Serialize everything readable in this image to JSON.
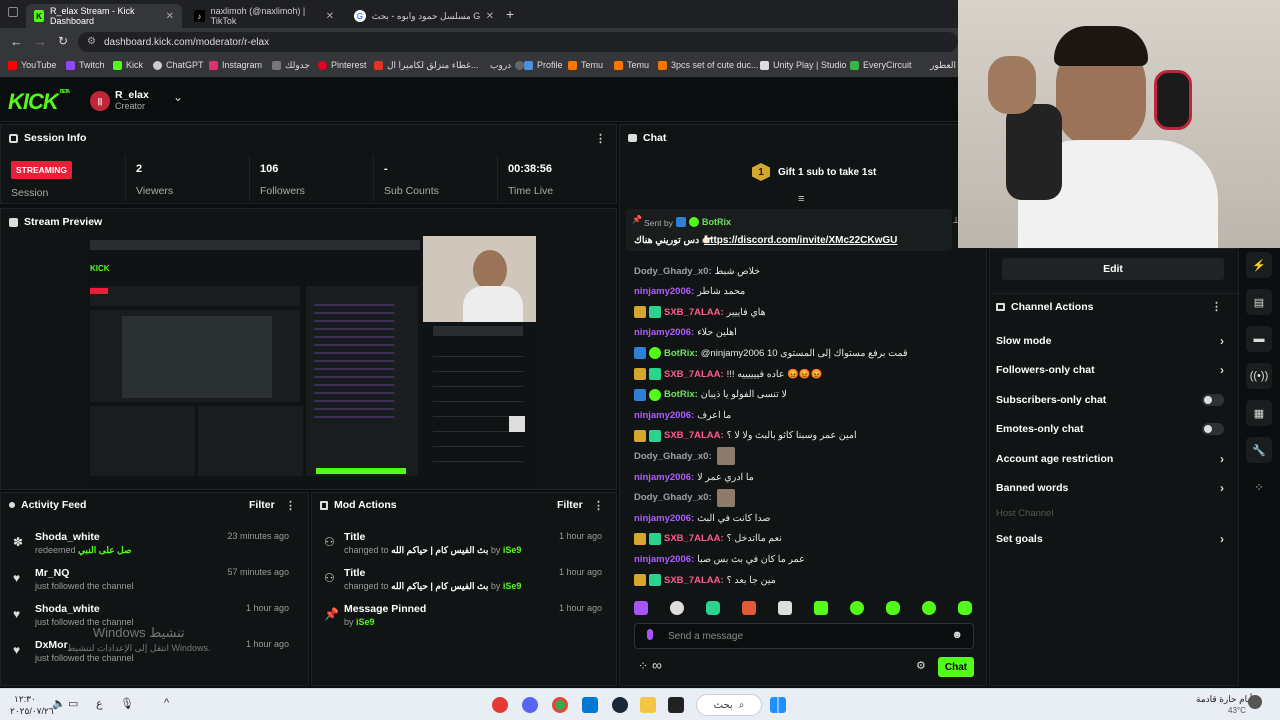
{
  "browser": {
    "tabs": [
      {
        "label": "R_elax Stream - Kick Dashboard",
        "active": true
      },
      {
        "label": "naxlimoh (@naxlimoh) | TikTok",
        "active": false
      },
      {
        "label": "مسلسل حمود وابوه - بحث Google",
        "active": false
      }
    ],
    "new_tab_symbol": "+",
    "url": "dashboard.kick.com/moderator/r-elax",
    "bookmarks": [
      "YouTube",
      "Twitch",
      "Kick",
      "ChatGPT",
      "Instagram",
      "جدولك",
      "Pinterest",
      "غطاء منزلق لكاميرا ال...",
      "دروب",
      "Profile",
      "Temu",
      "Temu",
      "3pcs set of cute duc...",
      "Unity Play | Studio",
      "EveryCircuit",
      "العطور"
    ]
  },
  "header": {
    "logo": "KICK",
    "logo_sup": "BETA",
    "channel": "R_elax",
    "role": "Creator"
  },
  "session": {
    "title": "Session Info",
    "status": "STREAMING",
    "status_label": "Session",
    "stats": [
      {
        "value": "2",
        "label": "Viewers"
      },
      {
        "value": "106",
        "label": "Followers"
      },
      {
        "value": "-",
        "label": "Sub Counts"
      },
      {
        "value": "00:38:56",
        "label": "Time Live"
      }
    ]
  },
  "preview": {
    "title": "Stream Preview"
  },
  "activity": {
    "title": "Activity Feed",
    "filter": "Filter",
    "items": [
      {
        "name": "Shoda_white",
        "sub": "redeemed",
        "extra": "صل على النبي",
        "time": "23 minutes ago"
      },
      {
        "name": "Mr_NQ",
        "sub": "just followed the channel",
        "time": "57 minutes ago"
      },
      {
        "name": "Shoda_white",
        "sub": "just followed the channel",
        "time": "1 hour ago"
      },
      {
        "name": "DxMor",
        "sub": "just followed the channel",
        "time": "1 hour ago"
      }
    ]
  },
  "mod_actions": {
    "title": "Mod Actions",
    "filter": "Filter",
    "items": [
      {
        "title": "Title",
        "sub": "changed to",
        "value": "بث الفيس كام | حياكم الله",
        "by": "iSe9",
        "time": "1 hour ago"
      },
      {
        "title": "Title",
        "sub": "changed to",
        "value": "بث الفيس كام | حياكم الله",
        "by": "iSe9",
        "time": "1 hour ago"
      },
      {
        "title": "Message Pinned",
        "sub": "by",
        "value": "",
        "by": "iSe9",
        "time": "1 hour ago"
      }
    ]
  },
  "chat": {
    "title": "Chat",
    "gift_count": "1",
    "gift_text": "Gift 1 sub to take 1st",
    "pinned": {
      "sent_by": "Sent by",
      "user": "BotRix",
      "prefix": "دس توريني هناك 👉🏻",
      "link": "https://discord.com/invite/XMc22CKwGU"
    },
    "messages": [
      {
        "user": "Dody_Ghady_x0",
        "text": "خلاص شبط",
        "color": "#9aa0a6",
        "badges": []
      },
      {
        "user": "ninjamy2006",
        "text": "محمد شاطر",
        "color": "#b15cff",
        "badges": []
      },
      {
        "user": "SXB_7ALAA",
        "text": "هاي فاييير",
        "color": "#ff5c8a",
        "badges": [
          "crown",
          "sub"
        ]
      },
      {
        "user": "ninjamy2006",
        "text": "اهلين حلاء",
        "color": "#b15cff",
        "badges": []
      },
      {
        "user": "BotRix",
        "text": "@ninjamy2006 قمت برفع مستواك إلى المستوى 10",
        "color": "#6fe35a",
        "badges": [
          "bot",
          "verified"
        ]
      },
      {
        "user": "SXB_7ALAA",
        "text": "!!! عاده فييييييه 😡😡😡",
        "color": "#ff5c8a",
        "badges": [
          "crown",
          "sub"
        ]
      },
      {
        "user": "BotRix",
        "text": "لا تنسى الفولو يا ذيبان",
        "color": "#6fe35a",
        "badges": [
          "bot",
          "verified"
        ]
      },
      {
        "user": "ninjamy2006",
        "text": "ما اعرف",
        "color": "#b15cff",
        "badges": []
      },
      {
        "user": "SXB_7ALAA",
        "text": "امين عمر وسبنا كاثو بالبث ولا لا ؟",
        "color": "#ff5c8a",
        "badges": [
          "crown",
          "sub"
        ]
      },
      {
        "user": "Dody_Ghady_x0",
        "text": "",
        "color": "#9aa0a6",
        "badges": [],
        "image": true
      },
      {
        "user": "ninjamy2006",
        "text": "ما ادري عمر لا",
        "color": "#b15cff",
        "badges": []
      },
      {
        "user": "Dody_Ghady_x0",
        "text": "",
        "color": "#9aa0a6",
        "badges": [],
        "image": true
      },
      {
        "user": "ninjamy2006",
        "text": "صدا كانت في البث",
        "color": "#b15cff",
        "badges": []
      },
      {
        "user": "SXB_7ALAA",
        "text": "نعم مااتدخل ؟",
        "color": "#ff5c8a",
        "badges": [
          "crown",
          "sub"
        ]
      },
      {
        "user": "ninjamy2006",
        "text": "عمر ما كان في بث بس صبا",
        "color": "#b15cff",
        "badges": []
      },
      {
        "user": "SXB_7ALAA",
        "text": "مين جا بعد ؟",
        "color": "#ff5c8a",
        "badges": [
          "crown",
          "sub"
        ]
      }
    ],
    "input_placeholder": "Send a message",
    "send_label": "Chat"
  },
  "right": {
    "edit_label": "Edit",
    "actions_title": "Channel Actions",
    "actions": [
      {
        "label": "Slow mode",
        "type": "chevron"
      },
      {
        "label": "Followers-only chat",
        "type": "chevron"
      },
      {
        "label": "Subscribers-only chat",
        "type": "toggle"
      },
      {
        "label": "Emotes-only chat",
        "type": "toggle"
      },
      {
        "label": "Account age restriction",
        "type": "chevron"
      },
      {
        "label": "Banned words",
        "type": "chevron"
      },
      {
        "label": "Host Channel",
        "type": "disabled"
      },
      {
        "label": "Set goals",
        "type": "chevron"
      }
    ]
  },
  "watermark": {
    "line1": "Windows تنشيط",
    "line2": "انتقل إلى الإعدادات لتنشيط Windows."
  },
  "taskbar": {
    "search": "بحث",
    "time": "١٢:٣٠",
    "date": "٢٠٢٥/٠٧/٢٦",
    "weather": "أيام حارة قادمة",
    "temp": "43°C",
    "lang": "ع"
  },
  "colors": {
    "accent": "#53fc18",
    "bg": "#0b0e0f",
    "panel": "#111415",
    "streaming": "#e8213a"
  }
}
